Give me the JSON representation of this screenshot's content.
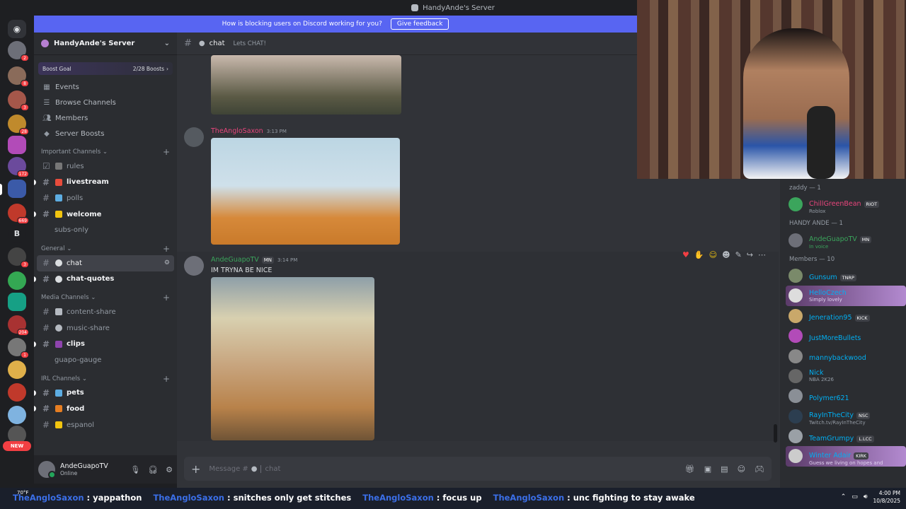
{
  "window": {
    "title": "HandyAnde's Server"
  },
  "banner": {
    "text": "How is blocking users on Discord working for you?",
    "button": "Give feedback"
  },
  "server": {
    "name": "HandyAnde's Server",
    "boost_goal_label": "Boost Goal",
    "boost_count": "2/28 Boosts"
  },
  "nav": [
    {
      "label": "Events",
      "icon": "calendar-icon"
    },
    {
      "label": "Browse Channels",
      "icon": "list-icon"
    },
    {
      "label": "Members",
      "icon": "members-icon"
    },
    {
      "label": "Server Boosts",
      "icon": "boost-icon"
    }
  ],
  "categories": {
    "important": "Important Channels",
    "general": "General",
    "media": "Media Channels",
    "irl": "IRL Channels"
  },
  "channels": {
    "rules": "rules",
    "livestream": "livestream",
    "polls": "polls",
    "welcome": "welcome",
    "subs_only": "subs-only",
    "chat": "chat",
    "chat_quotes": "chat-quotes",
    "content_share": "content-share",
    "music_share": "music-share",
    "clips": "clips",
    "guapo_gauge": "guapo-gauge",
    "pets": "pets",
    "food": "food",
    "espanol": "espanol"
  },
  "user": {
    "name": "AndeGuapoTV",
    "status": "Online"
  },
  "chat_header": {
    "channel": "chat",
    "topic": "Lets CHAT!"
  },
  "messages": [
    {
      "author": "TheAngloSaxon",
      "time": "3:13 PM",
      "author_color": "#e8457c"
    },
    {
      "author": "AndeGuapoTV",
      "time": "3:14 PM",
      "tag": "MN",
      "text": "IM TRYNA BE NICE",
      "author_color": "#3ba55c"
    }
  ],
  "composer": {
    "placeholder": "Message #",
    "channel": "chat"
  },
  "member_list": {
    "zaddy": {
      "title": "zaddy — 1",
      "members": [
        {
          "name": "ChillGreenBean",
          "tag": "RIOT",
          "sub": "Roblox",
          "color": "#e8457c"
        }
      ]
    },
    "handy_ande": {
      "title": "HANDY ANDE — 1",
      "members": [
        {
          "name": "AndeGuapoTV",
          "tag": "MN",
          "sub": "In voice",
          "color": "#3ba55c"
        }
      ]
    },
    "members": {
      "title": "Members — 10",
      "members": [
        {
          "name": "Gunsum",
          "tag": "TNRP",
          "sub": "",
          "color": "#00b0f4"
        },
        {
          "name": "HelloCzech",
          "tag": "",
          "sub": "Simply lovely",
          "color": "#00b0f4"
        },
        {
          "name": "Jeneration95",
          "tag": "KICK",
          "sub": "",
          "color": "#00b0f4"
        },
        {
          "name": "JustMoreBullets",
          "tag": "",
          "sub": "",
          "color": "#00b0f4"
        },
        {
          "name": "mannybackwood",
          "tag": "",
          "sub": "",
          "color": "#00b0f4"
        },
        {
          "name": "Nick",
          "tag": "",
          "sub": "NBA 2K26",
          "color": "#00b0f4"
        },
        {
          "name": "Polymer621",
          "tag": "",
          "sub": "",
          "color": "#00b0f4"
        },
        {
          "name": "RayInTheCity",
          "tag": "NSC",
          "sub": "Twitch.tv/RayInTheCity",
          "color": "#00b0f4"
        },
        {
          "name": "TeamGrumpy",
          "tag": "L.LCC",
          "sub": "",
          "color": "#00b0f4"
        },
        {
          "name": "Winter Adair",
          "tag": "KIRK",
          "sub": "Guess we living on hopes and",
          "color": "#00b0f4"
        }
      ]
    }
  },
  "ticker": [
    {
      "who": "TheAngloSaxon",
      "what": "yappathon"
    },
    {
      "who": "TheAngloSaxon",
      "what": "snitches only get stitches"
    },
    {
      "who": "TheAngloSaxon",
      "what": "focus up"
    },
    {
      "who": "TheAngloSaxon",
      "what": "unc fighting to stay awake"
    }
  ],
  "taskbar": {
    "weather": "70°F",
    "time": "4:00 PM",
    "date": "10/8/2025"
  },
  "rail": {
    "new_label": "NEW",
    "b_label": "B"
  }
}
